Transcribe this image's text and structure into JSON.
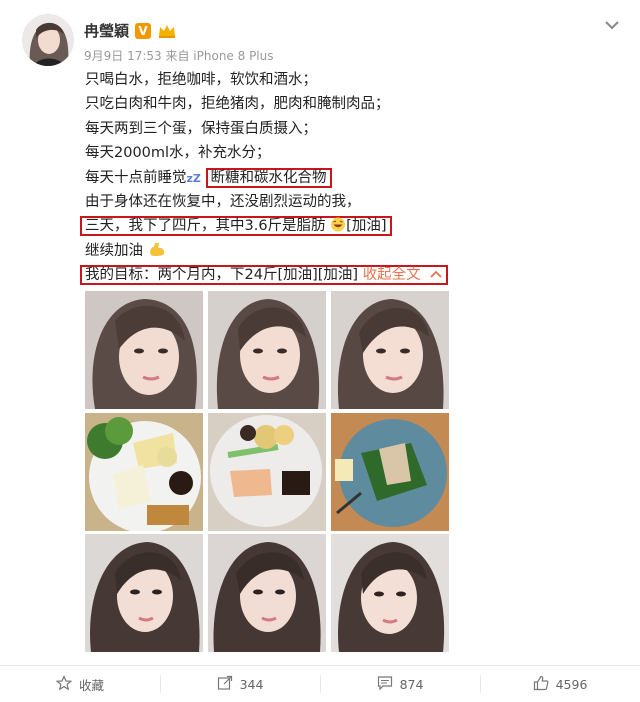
{
  "user": {
    "name": "冉瑩穎",
    "verified_icon": "v-badge-icon",
    "vip_icon": "crown-icon"
  },
  "post_meta": "9月9日 17:53 来自 iPhone 8 Plus",
  "post": {
    "lines": [
      "只喝白水，拒绝咖啡，软饮和酒水；",
      "只吃白肉和牛肉，拒绝猪肉，肥肉和腌制肉品；",
      "每天两到三个蛋，保持蛋白质摄入；",
      "每天2000ml水，补充水分；"
    ],
    "line5_prefix": "每天十点前睡觉",
    "line5_emoji": "zZ",
    "line5_highlight": "断糖和碳水化合物",
    "line6": "由于身体还在恢复中，还没剧烈运动的我，",
    "line7_prefix": "三天，我下了四斤，其中3.6斤是脂肪",
    "line7_suffix": "[加油]",
    "line8": "继续加油",
    "line9_text": "我的目标：两个月内，下24斤[加油][加油]",
    "collapse_label": "收起全文",
    "collapse_icon": "chevron-up-icon"
  },
  "actions": {
    "favorite_label": "收藏",
    "repost_count": "344",
    "comment_count": "874",
    "like_count": "4596"
  },
  "colors": {
    "highlight_border": "#c8161d",
    "link": "#eb7350",
    "verified": "#f39800"
  }
}
